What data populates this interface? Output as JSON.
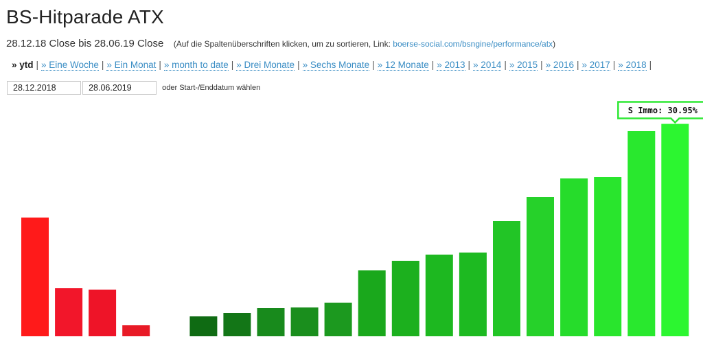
{
  "page": {
    "title": "BS-Hitparade ATX",
    "period": "28.12.18 Close bis 28.06.19 Close",
    "note_prefix": "(Auf die Spaltenüberschriften klicken, um zu sortieren, Link: ",
    "note_link": "boerse-social.com/bsngine/performance/atx",
    "note_suffix": ")"
  },
  "nav": {
    "items": [
      {
        "label": "» ytd",
        "active": true
      },
      {
        "label": "» Eine Woche"
      },
      {
        "label": "» Ein Monat"
      },
      {
        "label": "» month to date"
      },
      {
        "label": "» Drei Monate"
      },
      {
        "label": "» Sechs Monate"
      },
      {
        "label": "» 12 Monate"
      },
      {
        "label": "» 2013"
      },
      {
        "label": "» 2014"
      },
      {
        "label": "» 2015"
      },
      {
        "label": "» 2016"
      },
      {
        "label": "» 2017"
      },
      {
        "label": "» 2018"
      }
    ],
    "separator": "|"
  },
  "dates": {
    "start": "28.12.2018",
    "end": "28.06.2019",
    "hint": "oder Start-/Enddatum wählen"
  },
  "chart_data": {
    "type": "bar",
    "categories": [
      "",
      "",
      "",
      "",
      "",
      "",
      "",
      "",
      "",
      "",
      "",
      "",
      "",
      "",
      "",
      "",
      "",
      "",
      "",
      ""
    ],
    "values": [
      -17.3,
      -7.0,
      -6.8,
      -1.6,
      0,
      2.9,
      3.4,
      4.1,
      4.2,
      4.9,
      9.6,
      11.0,
      11.9,
      12.2,
      16.8,
      20.3,
      23.0,
      23.2,
      29.9,
      30.95
    ],
    "ylim": [
      -17.3,
      30.95
    ],
    "colors": {
      "negative": [
        "#ff1a1a",
        "#f2162a",
        "#ee1428",
        "#e81a26"
      ],
      "positive": [
        "#0f6b13",
        "#137617",
        "#188a1c",
        "#1a8e1d",
        "#1c991f",
        "#1aa81c",
        "#1cb01e",
        "#1db820",
        "#1dba21",
        "#22c526",
        "#26d12a",
        "#26dc2b",
        "#29e52d",
        "#29e82e",
        "#2cf630",
        "#2efd32"
      ]
    },
    "tooltip": {
      "index": 19,
      "text": "S Immo: 30.95%",
      "border_color": "#2ee834"
    }
  }
}
